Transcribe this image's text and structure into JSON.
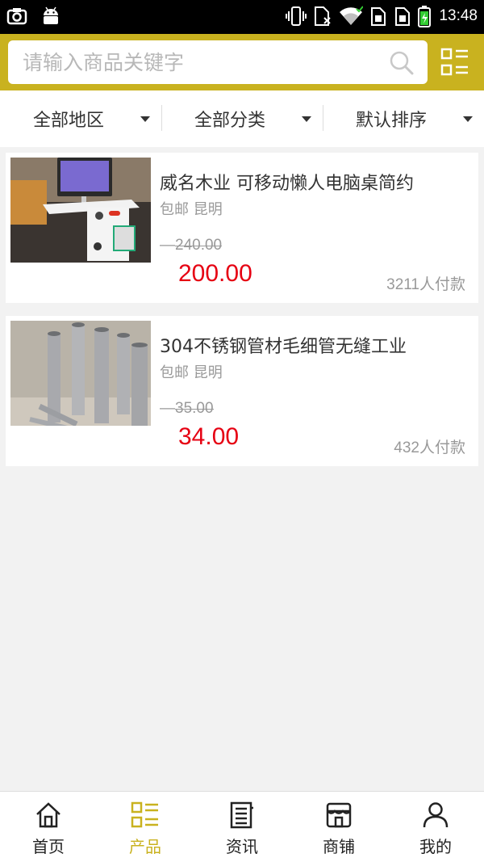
{
  "status_bar": {
    "time": "13:48",
    "left_icons": [
      "screenshot-icon",
      "android-icon"
    ],
    "right_icons": [
      "vibrate-icon",
      "no-sim-icon",
      "wifi-icon",
      "sim1-icon",
      "sim2-icon",
      "battery-icon"
    ]
  },
  "search": {
    "placeholder": "请输入商品关键字",
    "value": "",
    "icon": "search-icon",
    "menu_icon": "grid-menu-icon"
  },
  "filters": [
    {
      "label": "全部地区"
    },
    {
      "label": "全部分类"
    },
    {
      "label": "默认排序"
    }
  ],
  "products": [
    {
      "title": "威名木业 可移动懒人电脑桌简约",
      "meta": "包邮 昆明",
      "old_price": "240.00",
      "price": "200.00",
      "paid": "3211人付款",
      "image": "computer-desk-image"
    },
    {
      "title": "304不锈钢管材毛细管无缝工业",
      "meta": "包邮 昆明",
      "old_price": "35.00",
      "price": "34.00",
      "paid": "432人付款",
      "image": "steel-pipes-image"
    }
  ],
  "bottom_nav": [
    {
      "label": "首页",
      "icon": "home-icon"
    },
    {
      "label": "产品",
      "icon": "product-list-icon",
      "active": true
    },
    {
      "label": "资讯",
      "icon": "news-icon"
    },
    {
      "label": "商铺",
      "icon": "shop-icon"
    },
    {
      "label": "我的",
      "icon": "user-icon"
    }
  ],
  "colors": {
    "accent": "#c9b21f",
    "price": "#e60012",
    "muted": "#999999",
    "background": "#f2f2f2"
  }
}
